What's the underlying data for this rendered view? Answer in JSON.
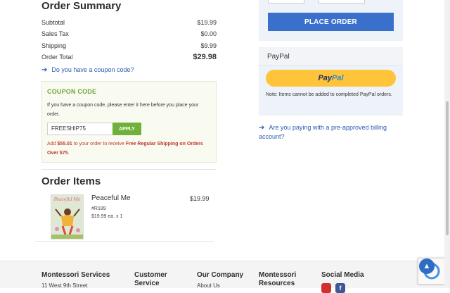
{
  "summary": {
    "title": "Order Summary",
    "rows": [
      {
        "label": "Subtotal",
        "value": "$19.99"
      },
      {
        "label": "Sales Tax",
        "value": "$0.00"
      },
      {
        "label": "Shipping",
        "value": "$9.99"
      }
    ],
    "total": {
      "label": "Order Total",
      "value": "$29.98"
    },
    "coupon_link": "Do you have a coupon code?"
  },
  "coupon": {
    "title": "COUPON CODE",
    "instructions": "If you have a coupon code, please enter it here before you place your order.",
    "input_value": "FREESHIP75",
    "apply_label": "APPLY",
    "note_prefix": "Add ",
    "note_amount": "$55.01",
    "note_middle": " to your order to receive ",
    "note_offer": "Free Regular Shipping on Orders Over $75",
    "note_suffix": "."
  },
  "items": {
    "title": "Order Items",
    "list": [
      {
        "name": "Peaceful Me",
        "price": "$19.99",
        "sku": "#R189",
        "qty_line": "$19.99 ea. x 1",
        "cover_title": "Peaceful Me"
      }
    ]
  },
  "checkout": {
    "place_order_label": "PLACE ORDER"
  },
  "paypal": {
    "heading": "PayPal",
    "button_pay": "Pay",
    "button_pal": "Pal",
    "note": "Note: Items cannot be added to completed PayPal orders."
  },
  "billing_link": "Are you paying with a pre-approved billing account?",
  "footer": {
    "columns": [
      {
        "heading": "Montessori Services",
        "first_line": "11 West 9th Street"
      },
      {
        "heading": "Customer Service",
        "first_line": ""
      },
      {
        "heading": "Our Company",
        "first_line": "About Us"
      },
      {
        "heading": "Montessori Resources",
        "first_line": ""
      },
      {
        "heading": "Social Media",
        "first_line": ""
      }
    ]
  },
  "colors": {
    "primary_blue": "#3a6fcc",
    "coupon_green": "#6fa53a",
    "alert_red": "#c0392b",
    "paypal_yellow": "#ffc43a"
  }
}
